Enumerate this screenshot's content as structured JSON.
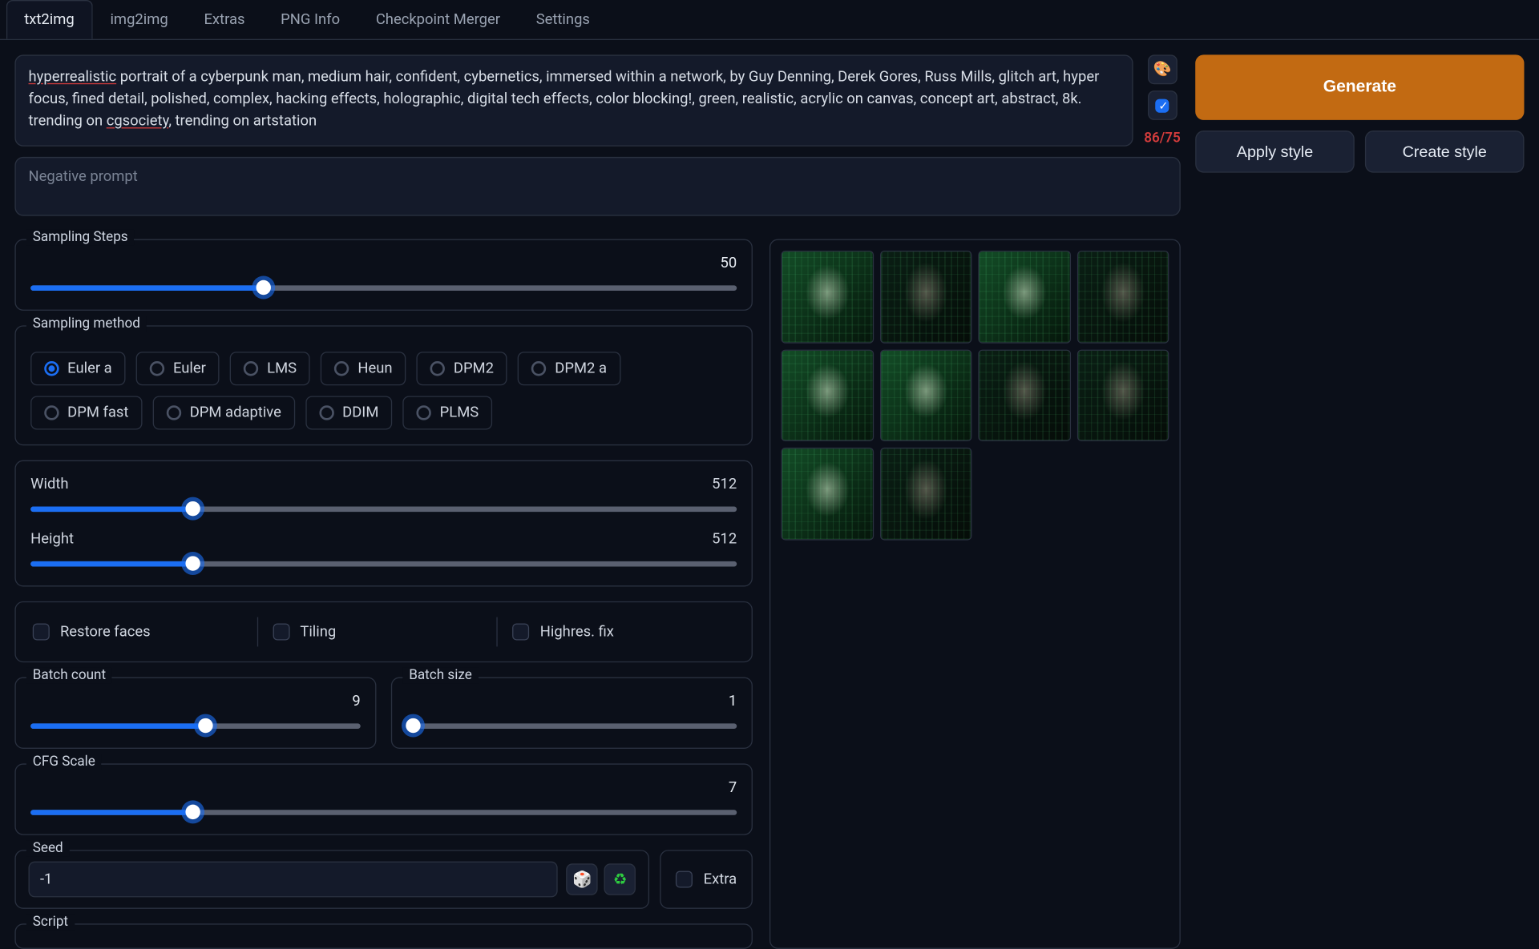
{
  "tabs": [
    "txt2img",
    "img2img",
    "Extras",
    "PNG Info",
    "Checkpoint Merger",
    "Settings"
  ],
  "active_tab": "txt2img",
  "prompt_hi1": "hyperrealistic",
  "prompt_rest1": " portrait of a cyberpunk man, medium hair, confident, cybernetics, immersed within a network, by Guy Denning, Derek Gores, Russ Mills, glitch art, hyper focus, fined detail, polished, complex, hacking effects, holographic, digital tech effects, color blocking!, green, realistic, acrylic on canvas, concept art, abstract, 8k. trending on ",
  "prompt_hi2": "cgsociety",
  "prompt_rest2": ", trending on artstation",
  "negative_placeholder": "Negative prompt",
  "token_count": "86/75",
  "interrogate_icon": "🎨",
  "check_icon": "✓",
  "buttons": {
    "generate": "Generate",
    "apply_style": "Apply style",
    "create_style": "Create style"
  },
  "sampling_steps": {
    "label": "Sampling Steps",
    "value": 50,
    "max": 150,
    "pct": 33
  },
  "sampling_method": {
    "label": "Sampling method",
    "options": [
      "Euler a",
      "Euler",
      "LMS",
      "Heun",
      "DPM2",
      "DPM2 a",
      "DPM fast",
      "DPM adaptive",
      "DDIM",
      "PLMS"
    ],
    "selected": "Euler a"
  },
  "width": {
    "label": "Width",
    "value": 512,
    "max": 2048,
    "pct": 23
  },
  "height": {
    "label": "Height",
    "value": 512,
    "max": 2048,
    "pct": 23
  },
  "checks": {
    "restore_faces": {
      "label": "Restore faces",
      "checked": false
    },
    "tiling": {
      "label": "Tiling",
      "checked": false
    },
    "highres_fix": {
      "label": "Highres. fix",
      "checked": false
    }
  },
  "batch_count": {
    "label": "Batch count",
    "value": 9,
    "max": 16,
    "pct": 53
  },
  "batch_size": {
    "label": "Batch size",
    "value": 1,
    "max": 8,
    "pct": 2
  },
  "cfg_scale": {
    "label": "CFG Scale",
    "value": 7,
    "max": 30,
    "pct": 23
  },
  "seed": {
    "label": "Seed",
    "value": "-1",
    "dice": "🎲",
    "recycle": "♻",
    "extra": "Extra"
  },
  "script": {
    "label": "Script"
  },
  "gallery_count": 10
}
